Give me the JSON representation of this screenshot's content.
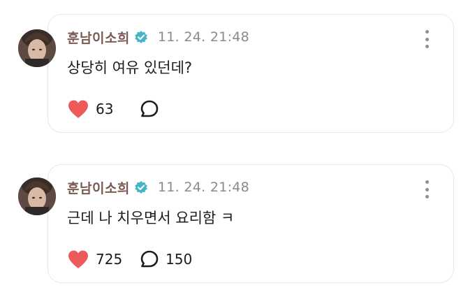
{
  "colors": {
    "author": "#7a5a52",
    "verified_badge": "#46b6c6",
    "heart": "#ee5a5a",
    "timestamp": "#8a8a8e"
  },
  "posts": [
    {
      "author": "훈남이소희",
      "verified": true,
      "timestamp": "11. 24. 21:48",
      "text": "상당히 여유 있던데?",
      "likes": "63",
      "replies": "",
      "icons": {
        "like": "heart-icon",
        "reply": "speech-bubble-icon",
        "more": "more-vertical-icon"
      }
    },
    {
      "author": "훈남이소희",
      "verified": true,
      "timestamp": "11. 24. 21:48",
      "text": "근데 나 치우면서 요리함 ㅋ",
      "likes": "725",
      "replies": "150",
      "icons": {
        "like": "heart-icon",
        "reply": "speech-bubble-icon",
        "more": "more-vertical-icon"
      }
    }
  ]
}
